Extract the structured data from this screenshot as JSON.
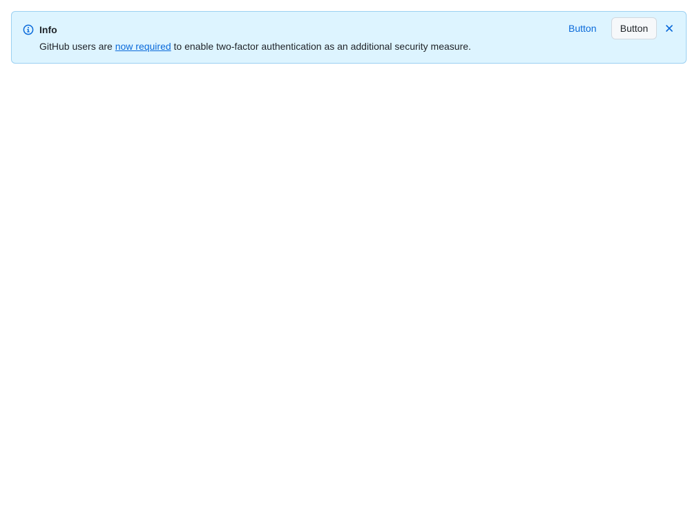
{
  "banner": {
    "variant": "info",
    "accent_color": "#0969da",
    "background_color": "#ddf4ff",
    "icon": "info-icon",
    "title": "Info",
    "message_before": "GitHub users are ",
    "message_link": "now required",
    "message_after": " to enable two-factor authentication as an additional security measure.",
    "primary_action_label": "Button",
    "secondary_action_label": "Button",
    "close_icon": "close-icon"
  }
}
